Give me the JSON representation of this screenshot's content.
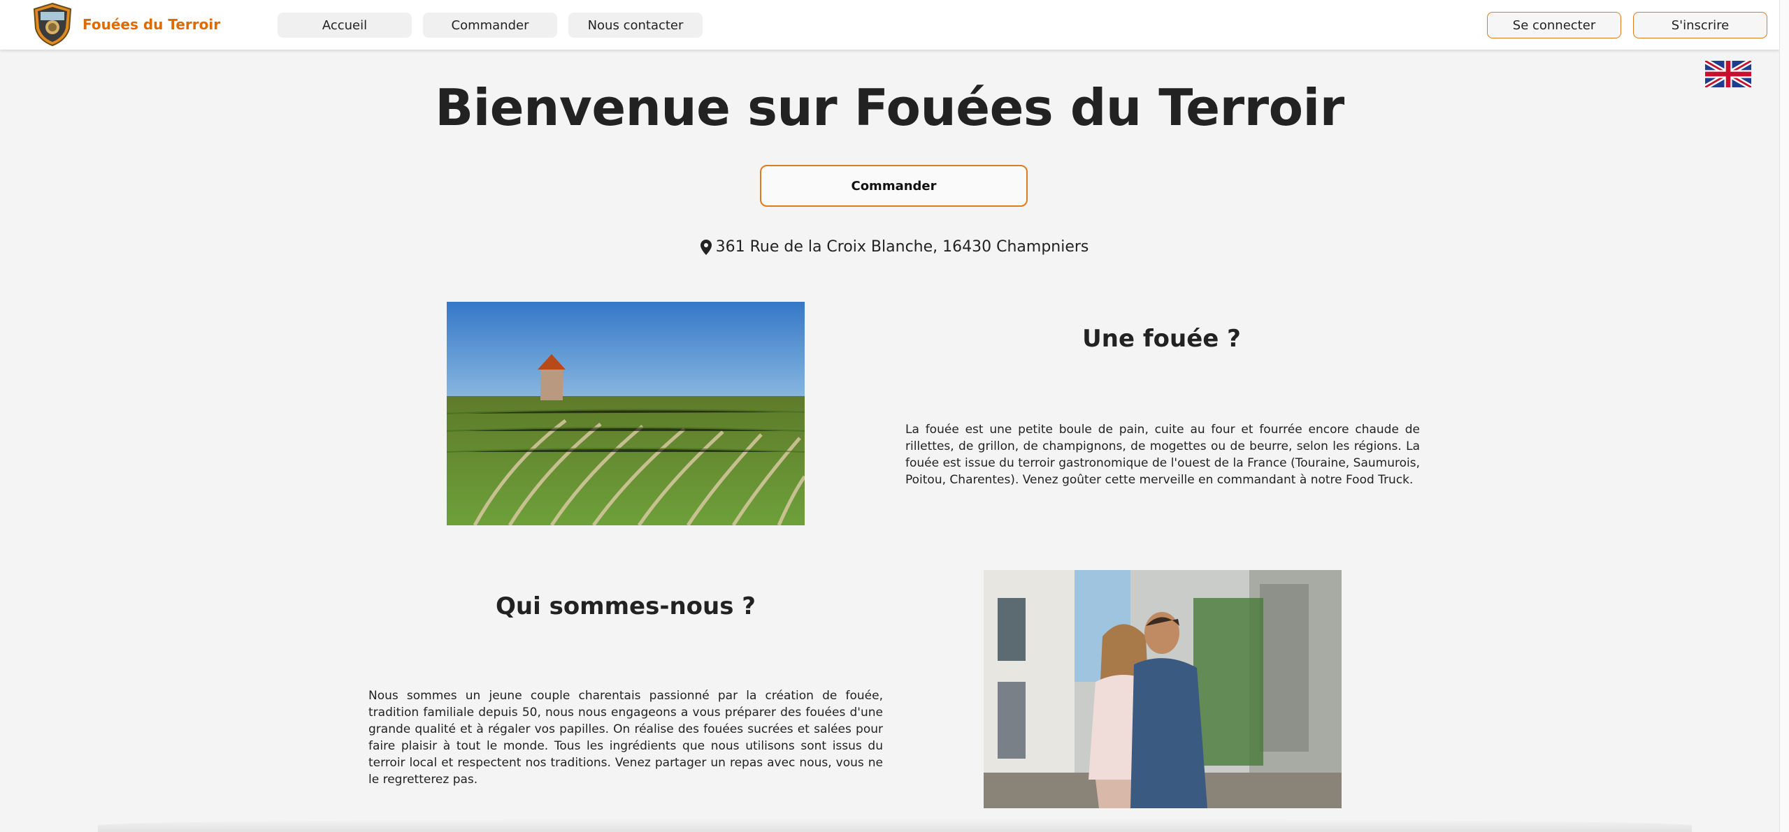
{
  "brand": {
    "name": "Fouées du Terroir"
  },
  "nav": {
    "items": [
      {
        "label": "Accueil"
      },
      {
        "label": "Commander"
      },
      {
        "label": "Nous contacter"
      }
    ],
    "login_label": "Se connecter",
    "signup_label": "S'inscrire"
  },
  "hero": {
    "title": "Bienvenue sur Fouées du Terroir",
    "order_label": "Commander",
    "address": "361 Rue de la Croix Blanche, 16430 Champniers"
  },
  "section_fouee": {
    "heading": "Une fouée ?",
    "text": "La fouée est une petite boule de pain, cuite au four et fourrée encore chaude de rillettes, de grillon, de champignons, de mogettes ou de beurre, selon les régions. La fouée est issue du terroir gastronomique de l'ouest de la France (Touraine, Saumurois, Poitou, Charentes). Venez goûter cette merveille en commandant à notre Food Truck."
  },
  "section_about": {
    "heading": "Qui sommes-nous ?",
    "text": "Nous sommes un jeune couple charentais passionné par la création de fouée, tradition familiale depuis 50, nous nous engageons a vous préparer des fouées d'une grande qualité et à régaler vos papilles. On réalise des fouées sucrées et salées pour faire plaisir à tout le monde. Tous les ingrédients que nous utilisons sont issus du terroir local et respectent nos traditions. Venez partager un repas avec nous, vous ne le regretterez pas."
  },
  "colors": {
    "accent": "#e06a00",
    "border": "#e07b1b",
    "background": "#f4f4f4"
  },
  "icons": {
    "language": "uk-flag-icon",
    "address": "map-pin-icon"
  }
}
